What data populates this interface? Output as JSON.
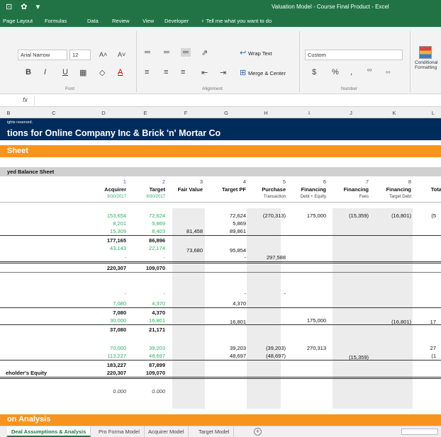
{
  "window": {
    "title": "Valuation Model - Course Final Product - Excel",
    "quick_access": [
      "⊡",
      "✿",
      "▾"
    ]
  },
  "ribbon_tabs": [
    "Page Layout",
    "Formulas",
    "Data",
    "Review",
    "View",
    "Developer",
    "♀ Tell me what you want to do"
  ],
  "ribbon": {
    "font_name": "Arial Narrow",
    "font_size": "12",
    "grow_font": "A˄",
    "shrink_font": "A˅",
    "bold": "B",
    "italic": "I",
    "underline": "U",
    "borders": "▦",
    "fill": "◇",
    "font_color": "A",
    "wrap_text": "Wrap Text",
    "merge_center": "Merge & Center",
    "number_format": "Custom",
    "currency": "$",
    "percent": "%",
    "comma": ",",
    "inc_decimal": "⁰⁰",
    "dec_decimal": "₀₀",
    "conditional_formatting": "Conditional Formatting",
    "groups": [
      "Font",
      "Alignment",
      "Number"
    ]
  },
  "formula_bar": {
    "fx": "fx",
    "value": ""
  },
  "columns": [
    "B",
    "C",
    "D",
    "E",
    "F",
    "G",
    "H",
    "I",
    "J",
    "K",
    "L"
  ],
  "sheet": {
    "copyright": "ights reserved.",
    "banner_title": "tions for Online Company Inc & Brick 'n' Mortar Co",
    "section_bar": "Sheet",
    "subsection": "yed Balance Sheet",
    "col_numbers": [
      "1",
      "2",
      "3",
      "4",
      "5",
      "6",
      "7",
      "8"
    ],
    "col_headers": [
      "Acquirer",
      "Target",
      "Fair Value",
      "Target PF",
      "Purchase",
      "Financing",
      "Financing",
      "Financing",
      "Tota"
    ],
    "col_sub": [
      "9/30/2017",
      "9/30/2017",
      "",
      "",
      "Transaction",
      "Debt + Equity",
      "Fees",
      "Target Debt"
    ],
    "rows": {
      "r1": [
        "153,654",
        "72,624",
        "",
        "72,624",
        "(270,313)",
        "175,000",
        "(15,359)",
        "(16,801)",
        "(5"
      ],
      "r2": [
        "8,201",
        "5,869",
        "",
        "5,869"
      ],
      "r3": [
        "15,309",
        "8,403",
        "81,458",
        "89,861"
      ],
      "r4": [
        "177,165",
        "86,896"
      ],
      "r5": [
        "43,143",
        "22,174",
        "73,680",
        "95,854"
      ],
      "r6": [
        "-",
        "-",
        "",
        "-",
        "297,588"
      ],
      "r7": [
        "220,307",
        "109,070"
      ],
      "r8": [
        "-",
        "-",
        "",
        "-",
        "-"
      ],
      "r9": [
        "7,080",
        "4,370",
        "",
        "4,370"
      ],
      "r10": [
        "7,080",
        "4,370"
      ],
      "r11": [
        "30,000",
        "16,801",
        "",
        "16,801",
        "",
        "175,000",
        "",
        "(16,801)",
        "17"
      ],
      "r12": [
        "37,080",
        "21,171"
      ],
      "r13": [
        "70,000",
        "39,203",
        "",
        "39,203",
        "(39,203)",
        "270,313",
        "",
        "",
        "27"
      ],
      "r14": [
        "113,227",
        "48,697",
        "",
        "48,697",
        "(48,697)",
        "",
        "(15,359)",
        "",
        "(1"
      ],
      "r15": [
        "183,227",
        "87,899"
      ],
      "r16": [
        "220,307",
        "109,070"
      ],
      "r17": [
        "0.000",
        "0.000"
      ]
    },
    "total_label": "eholder's Equity",
    "bottom_bar": "on Analysis"
  },
  "sheet_tabs": [
    "Deal Assumptions & Analysis",
    "Pro Forma Model",
    "Acquirer Model",
    "Target Model"
  ],
  "active_tab": "Deal Assumptions & Analysis",
  "add_sheet": "+"
}
